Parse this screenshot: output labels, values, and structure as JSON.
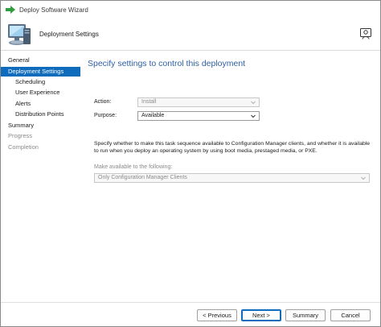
{
  "window": {
    "title": "Deploy Software Wizard"
  },
  "header": {
    "title": "Deployment Settings"
  },
  "nav": {
    "items": [
      {
        "label": "General",
        "state": "normal"
      },
      {
        "label": "Deployment Settings",
        "state": "active"
      },
      {
        "label": "Scheduling",
        "state": "normal"
      },
      {
        "label": "User Experience",
        "state": "normal"
      },
      {
        "label": "Alerts",
        "state": "normal"
      },
      {
        "label": "Distribution Points",
        "state": "normal"
      },
      {
        "label": "Summary",
        "state": "normal"
      },
      {
        "label": "Progress",
        "state": "disabled"
      },
      {
        "label": "Completion",
        "state": "disabled"
      }
    ]
  },
  "main": {
    "heading": "Specify settings to control this deployment",
    "action": {
      "label": "Action:",
      "value": "Install"
    },
    "purpose": {
      "label": "Purpose:",
      "value": "Available"
    },
    "description": "Specify whether to make this task sequence available to Configuration Manager clients, and whether it is available to run when you deploy an operating system by using boot media, prestaged media, or PXE.",
    "make_available": {
      "label": "Make available to the following:",
      "value": "Only Configuration Manager Clients"
    }
  },
  "footer": {
    "previous": "< Previous",
    "next": "Next >",
    "summary": "Summary",
    "cancel": "Cancel"
  },
  "colors": {
    "accent": "#0f6cbd",
    "heading": "#2e5fa5",
    "arrow": "#2e9e3e"
  }
}
